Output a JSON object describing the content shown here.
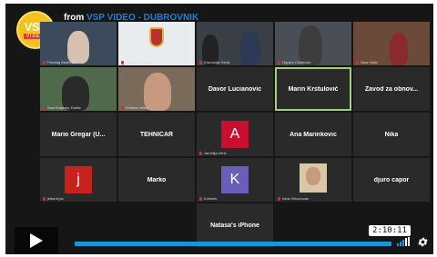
{
  "header": {
    "logo": {
      "main": "VSP",
      "sub": "VIDEO"
    },
    "from_prefix": "from",
    "channel": "VSP VIDEO - DUBROVNIK"
  },
  "tiles": [
    {
      "type": "video",
      "caption": "Predrag Markovic"
    },
    {
      "type": "video",
      "caption": "Grad Dubrovnik"
    },
    {
      "type": "video",
      "caption": "Krunoslav Simic"
    },
    {
      "type": "video",
      "caption": "Ognjen Celakovic"
    },
    {
      "type": "video",
      "caption": "Sara Vukic"
    },
    {
      "type": "video",
      "caption": "Sara Koljanin, Dzelic"
    },
    {
      "type": "video",
      "caption": "Kristina Jerkic"
    },
    {
      "type": "name",
      "name": "Davor Lucianovic",
      "caption": ""
    },
    {
      "type": "name",
      "name": "Marin Krstulović",
      "caption": "",
      "active": true
    },
    {
      "type": "name",
      "name": "Zavod za obnov...",
      "caption": ""
    },
    {
      "type": "name",
      "name": "Mario Gregar (U...",
      "caption": ""
    },
    {
      "type": "name",
      "name": "TEHNICAR",
      "caption": ""
    },
    {
      "type": "avatar",
      "letter": "A",
      "color": "#c8102e",
      "caption": "Jarmilija Veric"
    },
    {
      "type": "name",
      "name": "Ana Marinkovic",
      "caption": ""
    },
    {
      "type": "name",
      "name": "Nika",
      "caption": ""
    },
    {
      "type": "avatar",
      "letter": "j",
      "color": "#c8221e",
      "caption": "jelka krpic"
    },
    {
      "type": "name",
      "name": "Marko",
      "caption": ""
    },
    {
      "type": "avatar",
      "letter": "K",
      "color": "#6a5fb8",
      "caption": "Korisnik"
    },
    {
      "type": "video",
      "caption": "Ivica Vrtovcovac"
    },
    {
      "type": "name",
      "name": "djuro capor",
      "caption": ""
    },
    {
      "type": "name",
      "name": "Natasa's iPhone",
      "caption": ""
    }
  ],
  "player": {
    "time": "2:10:11",
    "progress": 1.0
  },
  "icons": {
    "play": "play-icon",
    "volume": "volume-icon",
    "settings": "gear-icon"
  }
}
